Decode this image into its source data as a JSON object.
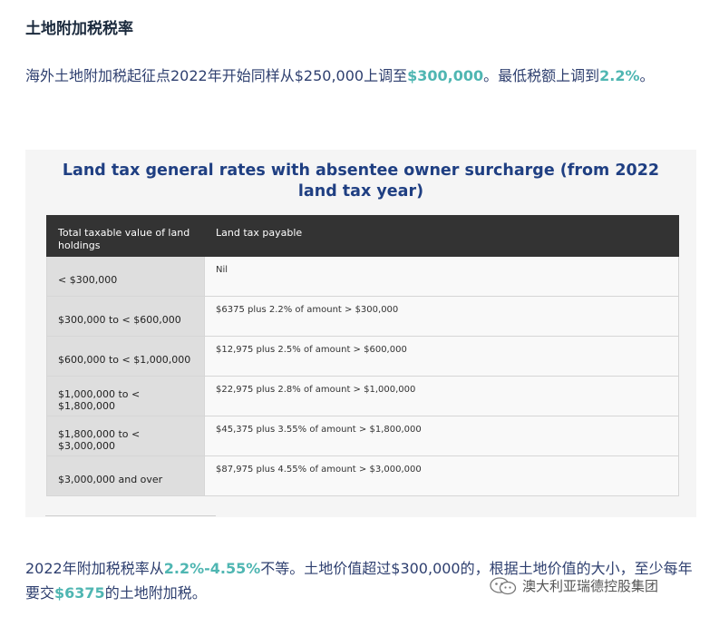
{
  "heading": "土地附加税税率",
  "para1": {
    "pre": "海外土地附加税起征点2022年开始同样从$250,000上调至",
    "amount": "$300,000",
    "mid": "。最低税额上调到",
    "rate": "2.2%",
    "post": "。"
  },
  "table_card": {
    "title": "Land tax general rates with absentee owner surcharge (from 2022 land tax year)",
    "headers": [
      "Total taxable value of land holdings",
      "Land tax payable"
    ],
    "rows": [
      {
        "range": "< $300,000",
        "payable": "Nil"
      },
      {
        "range": "$300,000 to < $600,000",
        "payable": "$6375 plus 2.2% of amount > $300,000"
      },
      {
        "range": "$600,000 to < $1,000,000",
        "payable": "$12,975 plus 2.5% of amount > $600,000"
      },
      {
        "range": "$1,000,000 to < $1,800,000",
        "payable": "$22,975 plus 2.8% of amount > $1,000,000"
      },
      {
        "range": "$1,800,000 to < $3,000,000",
        "payable": "$45,375 plus 3.55% of amount > $1,800,000"
      },
      {
        "range": "$3,000,000 and over",
        "payable": "$87,975 plus 4.55% of amount > $3,000,000"
      }
    ]
  },
  "para2": {
    "pre": "2022年附加税税率从",
    "range": "2.2%-4.55%",
    "mid": "不等。土地价值超过$300,000的，根据土地价值的大小，至少每年要交",
    "amount": "$6375",
    "post": "的土地附加税。"
  },
  "watermark": {
    "icon": "wechat-icon",
    "text": "澳大利亚瑞德控股集团"
  },
  "colors": {
    "highlight": "#4fb6b2",
    "body_text": "#2e3f6f",
    "table_title": "#1f3f82",
    "table_header_bg": "#333333"
  }
}
